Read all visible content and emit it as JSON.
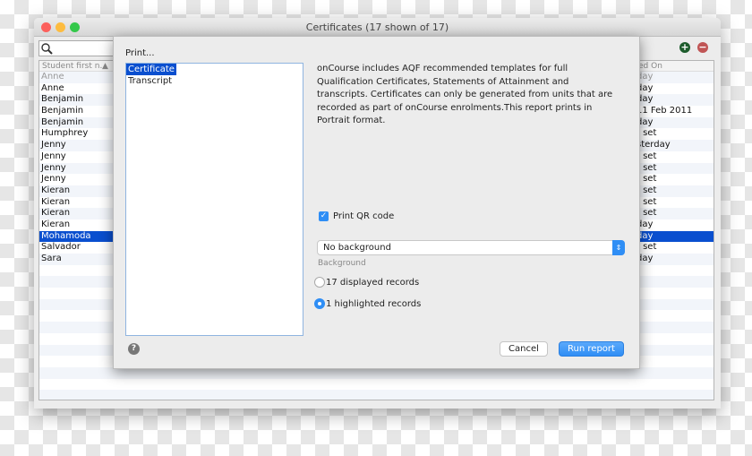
{
  "window": {
    "title": "Certificates (17 shown of 17)"
  },
  "list": {
    "header_first": "Student first n...",
    "header_sort": "▲",
    "header_last": "ed On",
    "rows": [
      {
        "name": "Anne",
        "date": "day",
        "dim": true
      },
      {
        "name": "Anne",
        "date": "day"
      },
      {
        "name": "Benjamin",
        "date": "day"
      },
      {
        "name": "Benjamin",
        "date": "11 Feb 2011"
      },
      {
        "name": "Benjamin",
        "date": "day"
      },
      {
        "name": "Humphrey",
        "date": "t set"
      },
      {
        "name": "Jenny",
        "date": "sterday"
      },
      {
        "name": "Jenny",
        "date": "t set"
      },
      {
        "name": "Jenny",
        "date": "t set"
      },
      {
        "name": "Jenny",
        "date": "t set"
      },
      {
        "name": "Kieran",
        "date": "t set"
      },
      {
        "name": "Kieran",
        "date": "t set"
      },
      {
        "name": "Kieran",
        "date": "t set"
      },
      {
        "name": "Kieran",
        "date": "day"
      },
      {
        "name": "Mohamoda",
        "date": "day",
        "selected": true
      },
      {
        "name": "Salvador",
        "date": "t set"
      },
      {
        "name": "Sara",
        "date": "day"
      }
    ]
  },
  "dialog": {
    "print_label": "Print...",
    "templates": [
      "Certificate",
      "Transcript"
    ],
    "selected_template": "Certificate",
    "description": "onCourse includes AQF recommended templates for full Qualification Certificates, Statements of Attainment and transcripts. Certificates can only be generated from units that are recorded as part of onCourse enrolments.This report prints in Portrait format.",
    "qr_label": "Print QR code",
    "qr_checked": true,
    "background_value": "No background",
    "background_label": "Background",
    "radio_displayed": "17 displayed records",
    "radio_highlighted": "1 highlighted records",
    "selected_radio": "highlighted",
    "cancel": "Cancel",
    "run": "Run report",
    "help": "?"
  },
  "colors": {
    "accent": "#2f8ef5",
    "selection": "#0a4fcf",
    "add": "#1d5c2c",
    "remove": "#c05555"
  }
}
